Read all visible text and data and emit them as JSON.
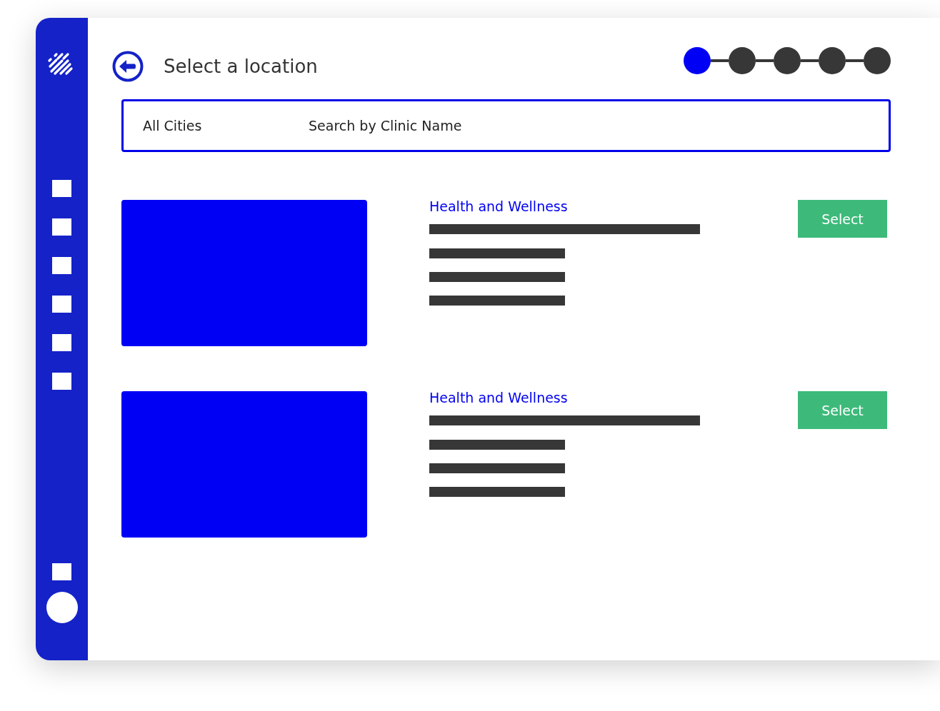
{
  "header": {
    "title": "Select a location"
  },
  "steps": [
    {
      "selected": true
    },
    {
      "selected": false
    },
    {
      "selected": false
    },
    {
      "selected": false
    },
    {
      "selected": false
    }
  ],
  "search": {
    "city": "All Cities",
    "placeholder": "Search by Clinic Name"
  },
  "clinics": [
    {
      "name": "Health and Wellness",
      "button": "Select"
    },
    {
      "name": "Health and Wellness",
      "button": "Select"
    }
  ]
}
